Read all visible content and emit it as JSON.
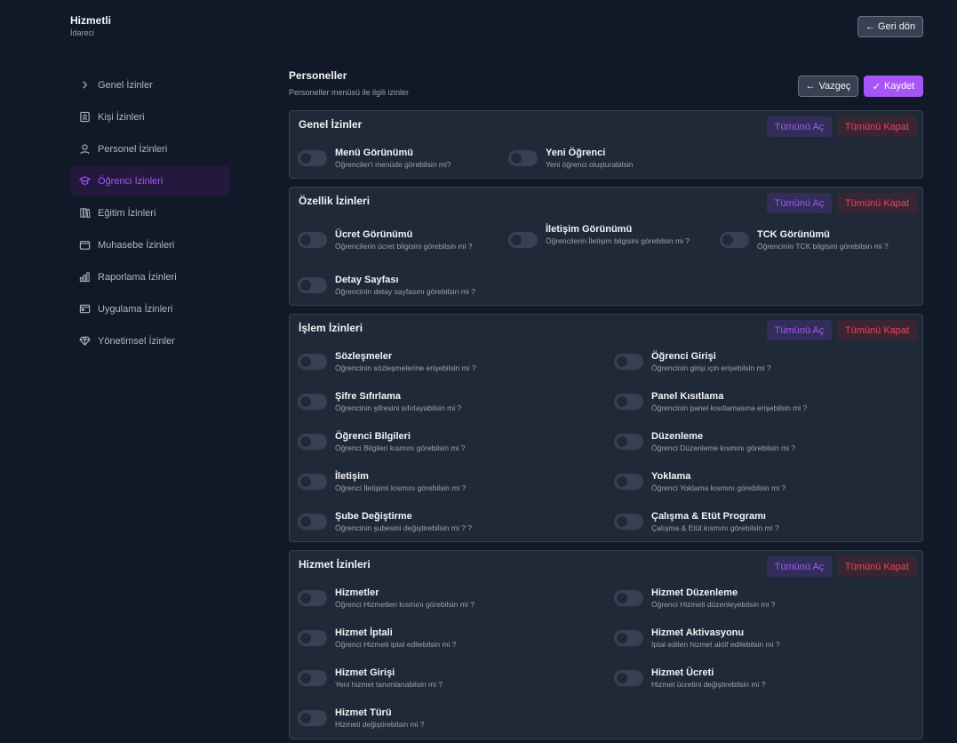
{
  "brand": {
    "title": "Hizmetli",
    "subtitle": "İdareci"
  },
  "header": {
    "back_label": "Geri dön"
  },
  "sidebar": {
    "items": [
      {
        "label": "Genel İzinler",
        "icon": "chevron-right-icon"
      },
      {
        "label": "Kişi İzinleri",
        "icon": "contact-card-icon"
      },
      {
        "label": "Personel İzinleri",
        "icon": "user-icon"
      },
      {
        "label": "Öğrenci İzinleri",
        "icon": "graduation-cap-icon",
        "active": true
      },
      {
        "label": "Eğitim İzinleri",
        "icon": "books-icon"
      },
      {
        "label": "Muhasebe İzinleri",
        "icon": "wallet-icon"
      },
      {
        "label": "Raporlama İzinleri",
        "icon": "bar-chart-icon"
      },
      {
        "label": "Uygulama İzinleri",
        "icon": "app-window-icon"
      },
      {
        "label": "Yönetimsel İzinler",
        "icon": "diamond-icon"
      }
    ]
  },
  "main": {
    "title": "Personeller",
    "subtitle": "Personeller menüsü ile ilgili izinler",
    "cancel_label": "Vazgeç",
    "save_label": "Kaydet",
    "open_all_label": "Tümünü Aç",
    "close_all_label": "Tümünü Kapat",
    "sections": [
      {
        "title": "Genel İzinler",
        "items": [
          {
            "label": "Menü Görünümü",
            "desc": "Öğrenciler'i menüde görebilsin mi?"
          },
          {
            "label": "Yeni Öğrenci",
            "desc": "Yeni öğrenci oluşturabilsin"
          }
        ]
      },
      {
        "title": "Özellik İzinleri",
        "items": [
          {
            "label": "Ücret Görünümü",
            "desc": "Öğrencilerin ücret bilgisini görebilsin mi ?"
          },
          {
            "label": "İletişim Görünümü",
            "desc": "Öğrencilerin İletişim bilgisini görebilsin mi ?"
          },
          {
            "label": "TCK Görünümü",
            "desc": "Öğrencinin TCK bilgisini görebilsin mi ?"
          },
          {
            "label": "Detay Sayfası",
            "desc": "Öğrencinin detay sayfasını görebilsin mi ?"
          }
        ]
      },
      {
        "title": "İşlem İzinleri",
        "items": [
          {
            "label": "Sözleşmeler",
            "desc": "Öğrencinin sözleşmelerine erişebilsin mi ?"
          },
          {
            "label": "Öğrenci Girişi",
            "desc": "Öğrencinin girişi için erişebilsin mi ?"
          },
          {
            "label": "Şifre Sıfırlama",
            "desc": "Öğrencinin şifresini sıfırlayabilsin mi ?"
          },
          {
            "label": "Panel Kısıtlama",
            "desc": "Öğrencinin panel kısıtlamasına erişebilsin mi ?"
          },
          {
            "label": "Öğrenci Bilgileri",
            "desc": "Öğrenci Bilgileri kısmını görebilsin mi ?"
          },
          {
            "label": "Düzenleme",
            "desc": "Öğrenci Düzenleme kısmını görebilsin mi ?"
          },
          {
            "label": "İletişim",
            "desc": "Öğrenci İletişimi kısmını görebilsin mi ?"
          },
          {
            "label": "Yoklama",
            "desc": "Öğrenci Yoklama kısmını görebilsin mi ?"
          },
          {
            "label": "Şube Değiştirme",
            "desc": "Öğrencinin şubesini değiştirebilsin mi ? ?"
          },
          {
            "label": "Çalışma & Etüt Programı",
            "desc": "Çalışma & Etüt kısmını görebilsin mi ?"
          }
        ]
      },
      {
        "title": "Hizmet İzinleri",
        "items": [
          {
            "label": "Hizmetler",
            "desc": "Öğrenci Hizmetleri kısmını görebilsin mi ?"
          },
          {
            "label": "Hizmet Düzenleme",
            "desc": "Öğrenci Hizmeti düzenleyebilsin mi ?"
          },
          {
            "label": "Hizmet İptali",
            "desc": "Öğrenci Hizmeti iptal edilebilsin mi ?"
          },
          {
            "label": "Hizmet Aktivasyonu",
            "desc": "İptal edilen hizmet aktif edilebilsin mi ?"
          },
          {
            "label": "Hizmet Girişi",
            "desc": "Yeni hizmet tanımlanabilsin mi ?"
          },
          {
            "label": "Hizmet Ücreti",
            "desc": "Hizmet ücretini değiştirebilsin mi ?"
          },
          {
            "label": "Hizmet Türü",
            "desc": "Hizmeti değiştirebilsin mi ?"
          }
        ]
      }
    ]
  }
}
